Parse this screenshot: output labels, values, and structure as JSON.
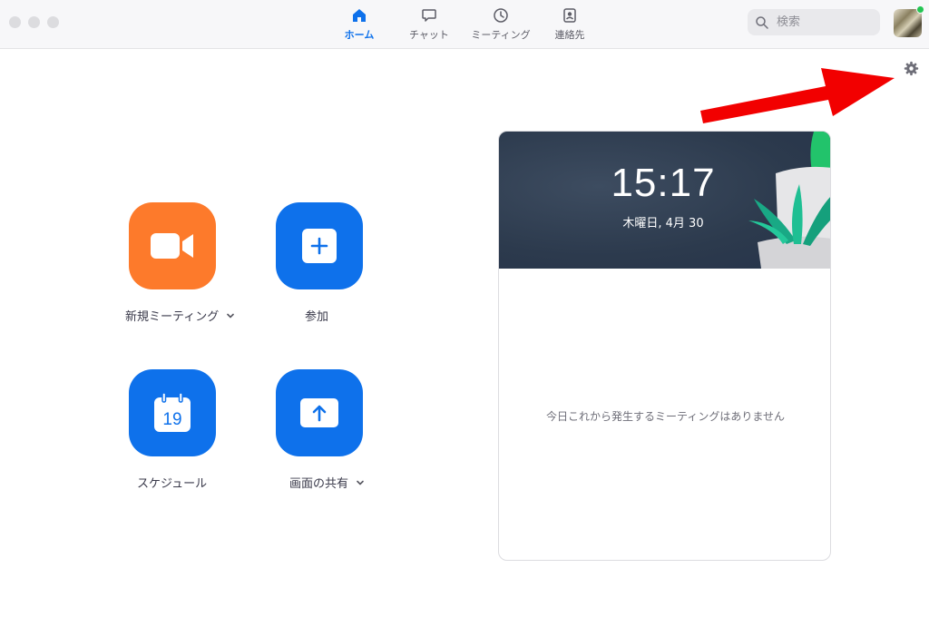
{
  "nav": {
    "tabs": [
      {
        "label": "ホーム",
        "icon": "home-icon",
        "active": true
      },
      {
        "label": "チャット",
        "icon": "chat-icon",
        "active": false
      },
      {
        "label": "ミーティング",
        "icon": "clock-icon",
        "active": false
      },
      {
        "label": "連絡先",
        "icon": "contacts-icon",
        "active": false
      }
    ]
  },
  "search": {
    "placeholder": "検索",
    "value": ""
  },
  "colors": {
    "accent": "#0e71eb",
    "new_meeting": "#fd7a2b",
    "status_online": "#23c552",
    "annotation_arrow": "#f20000"
  },
  "actions": {
    "new_meeting": {
      "label": "新規ミーティング",
      "icon": "video-camera-icon",
      "has_dropdown": true
    },
    "join": {
      "label": "参加",
      "icon": "plus-icon"
    },
    "schedule": {
      "label": "スケジュール",
      "icon": "calendar-icon",
      "calendar_day": "19"
    },
    "share_screen": {
      "label": "画面の共有",
      "icon": "share-screen-icon",
      "has_dropdown": true
    }
  },
  "card": {
    "time": "15:17",
    "date": "木曜日, 4月 30",
    "empty_message": "今日これから発生するミーティングはありません"
  }
}
